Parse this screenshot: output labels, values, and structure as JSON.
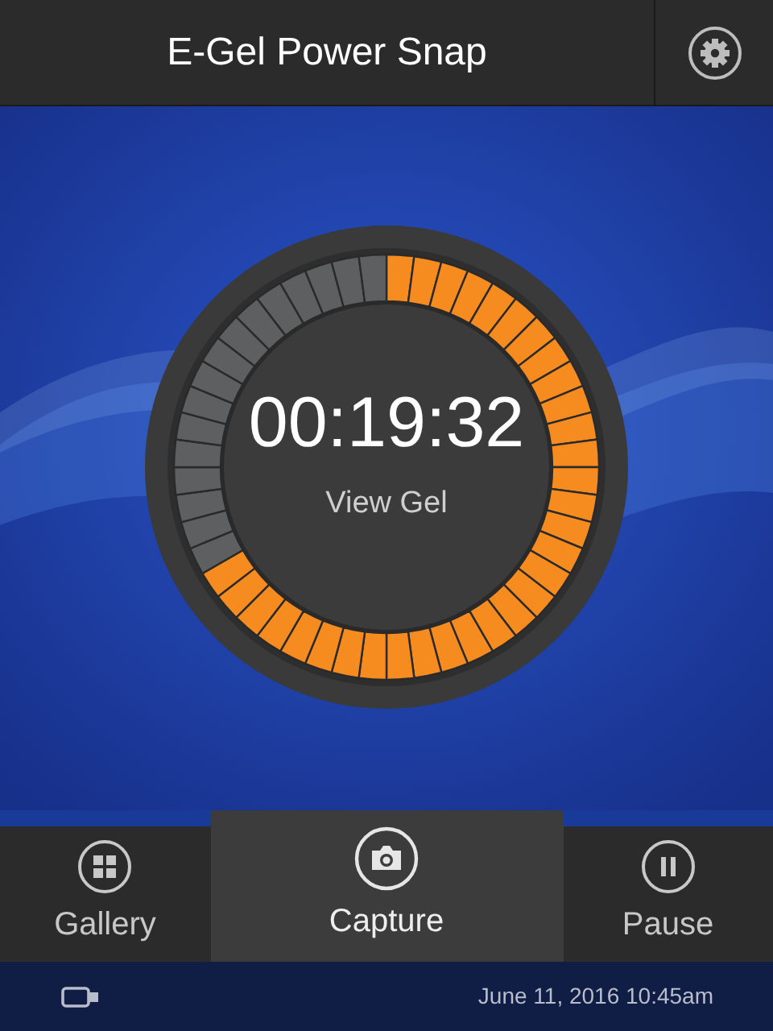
{
  "header": {
    "title": "E-Gel Power Snap"
  },
  "timer": {
    "time": "00:19:32",
    "link": "View Gel"
  },
  "tabs": [
    {
      "label": "Gallery",
      "kind": "gallery",
      "selected": false
    },
    {
      "label": "Capture",
      "kind": "capture",
      "selected": true
    },
    {
      "label": "Pause",
      "kind": "pause",
      "selected": false
    }
  ],
  "status_bar": {
    "datetime": "June 11, 2016 10:45am"
  }
}
